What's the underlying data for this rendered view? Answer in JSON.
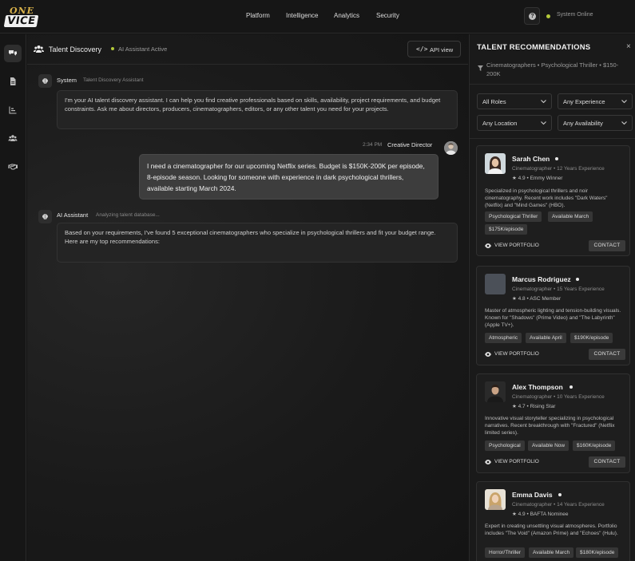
{
  "brand": {
    "logo_top": "ONE",
    "logo_bottom": "VICE"
  },
  "nav": {
    "items": [
      "Platform",
      "Intelligence",
      "Analytics",
      "Security"
    ]
  },
  "system": {
    "help": "?",
    "status": "System Online",
    "status_color": "#b4c93a"
  },
  "chat": {
    "title": "Talent Discovery",
    "status": "AI Assistant Active",
    "api_button": "API view",
    "api_glyph": "</>",
    "messages": [
      {
        "sender": "System",
        "sub": "Talent Discovery Assistant",
        "text": "I'm your AI talent discovery assistant. I can help you find creative professionals based on skills, availability, project requirements, and budget constraints. Ask me about directors, producers, cinematographers, editors, or any other talent you need for your projects."
      },
      {
        "sender": "Creative Director",
        "time": "2:34 PM",
        "text": "I need a cinematographer for our upcoming Netflix series. Budget is $150K-200K per episode, 8-episode season. Looking for someone with experience in dark psychological thrillers, available starting March 2024."
      },
      {
        "sender": "AI Assistant",
        "sub": "Analyzing talent database...",
        "text": "Based on your requirements, I've found 5 exceptional cinematographers who specialize in psychological thrillers and fit your budget range. Here are my top recommendations:"
      }
    ]
  },
  "panel": {
    "title": "TALENT RECOMMENDATIONS",
    "close": "×",
    "filter_summary": "Cinematographers • Psychological Thriller • $150-200K",
    "filters": [
      "All Roles",
      "Any Experience",
      "Any Location",
      "Any Availability"
    ],
    "view_portfolio": "VIEW PORTFOLIO",
    "contact": "CONTACT",
    "cards": [
      {
        "name": "Sarah Chen",
        "meta": "Cinematographer • 12 Years Experience",
        "rating": "4.9 • Emmy Winner",
        "desc": "Specialized in psychological thrillers and noir cinematography. Recent work includes \"Dark Waters\" (Netflix) and \"Mind Games\" (HBO).",
        "tags": [
          "Psychological Thriller",
          "Available March",
          "$175K/episode"
        ]
      },
      {
        "name": "Marcus Rodriguez",
        "meta": "Cinematographer • 15 Years Experience",
        "rating": "4.8 • ASC Member",
        "desc": "Master of atmospheric lighting and tension-building visuals. Known for \"Shadows\" (Prime Video) and \"The Labyrinth\" (Apple TV+).",
        "tags": [
          "Atmospheric",
          "Available April",
          "$190K/episode"
        ]
      },
      {
        "name": "Alex Thompson",
        "meta": "Cinematographer • 10 Years Experience",
        "rating": "4.7 • Rising Star",
        "desc": "Innovative visual storyteller specializing in psychological narratives. Recent breakthrough with \"Fractured\" (Netflix limited series).",
        "tags": [
          "Psychological",
          "Available Now",
          "$160K/episode"
        ]
      },
      {
        "name": "Emma Davis",
        "meta": "Cinematographer • 14 Years Experience",
        "rating": "4.9 • BAFTA Nominee",
        "desc": "Expert in creating unsettling visual atmospheres. Portfolio includes \"The Void\" (Amazon Prime) and \"Echoes\" (Hulu).",
        "tags": [
          "Horror/Thriller",
          "Available March",
          "$180K/episode"
        ]
      }
    ]
  }
}
